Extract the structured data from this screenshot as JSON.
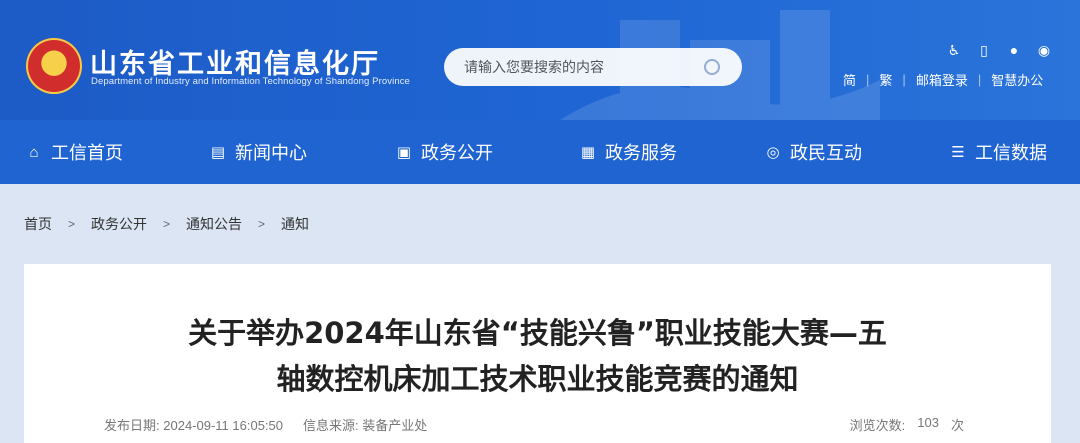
{
  "header": {
    "site_title": "山东省工业和信息化厅",
    "site_subtitle": "Department of Industry and Information Technology of Shandong Province",
    "search_placeholder": "请输入您要搜索的内容",
    "tools": {
      "accessibility_icon": "wheelchair-icon",
      "mobile_icon": "phone-icon",
      "wechat_icon": "wechat-icon",
      "weibo_icon": "weibo-icon"
    },
    "links": [
      "简",
      "繁",
      "邮箱登录",
      "智慧办公"
    ]
  },
  "nav": [
    {
      "label": "工信首页",
      "icon": "home-icon"
    },
    {
      "label": "新闻中心",
      "icon": "news-icon"
    },
    {
      "label": "政务公开",
      "icon": "monitor-icon"
    },
    {
      "label": "政务服务",
      "icon": "service-icon"
    },
    {
      "label": "政民互动",
      "icon": "chat-icon"
    },
    {
      "label": "工信数据",
      "icon": "database-icon"
    }
  ],
  "breadcrumb": [
    "首页",
    "政务公开",
    "通知公告",
    "通知"
  ],
  "article": {
    "title_line1": "关于举办2024年山东省“技能兴鲁”职业技能大赛—五",
    "title_line2": "轴数控机床加工技术职业技能竞赛的通知",
    "publish_label": "发布日期:",
    "publish_date": "2024-09-11 16:05:50",
    "source_label": "信息来源:",
    "source": "装备产业处",
    "views_label": "浏览次数:",
    "views": "103",
    "views_unit": "次"
  },
  "colors": {
    "header_blue": "#1f64d0",
    "page_bg": "#dbe5f3"
  }
}
